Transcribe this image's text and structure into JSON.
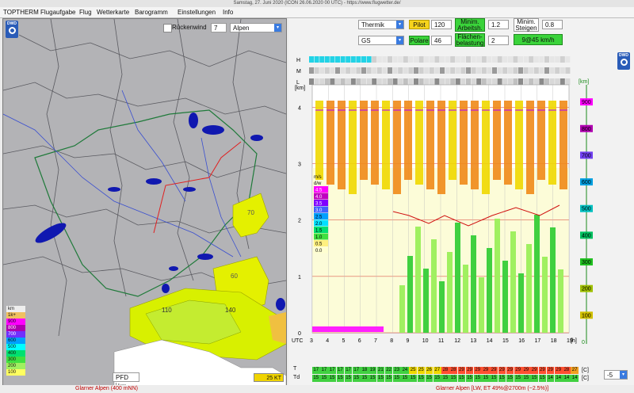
{
  "window_title": "Samstag, 27. Juni 2020 (ICON 26.06.2020 00 UTC) - https://www.flugwetter.de/",
  "menu": [
    "TOPTHERM",
    "Flugaufgabe",
    "Flug",
    "Wetterkarte",
    "Barogramm",
    "Einstellungen",
    "Info"
  ],
  "map": {
    "ruckenwind_label": "Rückenwind",
    "ruckenwind_value": "7",
    "region": "Alpen",
    "region_labels": [
      "70",
      "60",
      "110",
      "140"
    ],
    "pfd_label": "PFD",
    "km_label": "km",
    "wind_label": "25 KT",
    "legend_title": "km",
    "legend": [
      {
        "label": "1k+",
        "color": "#f0c060"
      },
      {
        "label": "900",
        "color": "#ff00ff"
      },
      {
        "label": "800",
        "color": "#b000b0"
      },
      {
        "label": "700",
        "color": "#7030ff"
      },
      {
        "label": "600",
        "color": "#00a0ff"
      },
      {
        "label": "500",
        "color": "#00ffff"
      },
      {
        "label": "400",
        "color": "#00e070"
      },
      {
        "label": "300",
        "color": "#40e040"
      },
      {
        "label": "200",
        "color": "#a0f060"
      },
      {
        "label": "100",
        "color": "#ffff60"
      }
    ]
  },
  "controls": {
    "mode": "Thermik",
    "pilot_label": "Pilot",
    "pilot_value": "120",
    "minim_arbeits_label1": "Minim.",
    "minim_arbeits_label2": "Arbeitsh.",
    "minim_arbeits_value": "1.2",
    "minim_steigen_label1": "Minim.",
    "minim_steigen_label2": "Steigen",
    "minim_steigen_value": "0.8",
    "glider": "GS",
    "polare_label": "Polare",
    "polare_value": "46",
    "flaechen_label1": "Flächen-",
    "flaechen_label2": "belastung",
    "flaechen_value": "2",
    "speed_button": "9@45 km/h"
  },
  "chart": {
    "rows_hml": [
      "H",
      "M",
      "L"
    ],
    "left_unit": "[km]",
    "left_ticks": [
      "0",
      "1",
      "2",
      "3",
      "4"
    ],
    "utc_label": "UTC",
    "hours": [
      "3",
      "4",
      "5",
      "6",
      "7",
      "8",
      "9",
      "10",
      "11",
      "12",
      "13",
      "14",
      "15",
      "16",
      "17",
      "18",
      "19"
    ],
    "hour_unit": "[h]",
    "right_unit": "[km]",
    "right_ticks": [
      "0",
      "100",
      "200",
      "300",
      "400",
      "500",
      "600",
      "700",
      "800",
      "900"
    ],
    "climb_legend_title": [
      "m/s",
      "d/w"
    ],
    "climb_legend": [
      {
        "label": "4.5",
        "color": "#ff00ff"
      },
      {
        "label": "4.0",
        "color": "#c000c0"
      },
      {
        "label": "3.5",
        "color": "#8000ff"
      },
      {
        "label": "3.0",
        "color": "#4060ff"
      },
      {
        "label": "2.5",
        "color": "#00a0ff"
      },
      {
        "label": "2.0",
        "color": "#00e0ff"
      },
      {
        "label": "1.5",
        "color": "#00e070"
      },
      {
        "label": "1.0",
        "color": "#40e040"
      },
      {
        "label": "0.5",
        "color": "#fff080"
      },
      {
        "label": "0.0",
        "color": "#ffffd0"
      }
    ],
    "T_label": "T",
    "Td_label": "Td",
    "T_values": [
      "17",
      "17",
      "17",
      "17",
      "17",
      "17",
      "18",
      "19",
      "21",
      "22",
      "23",
      "24",
      "25",
      "25",
      "26",
      "27",
      "28",
      "28",
      "29",
      "29",
      "29",
      "29",
      "29",
      "29",
      "29",
      "29",
      "29",
      "29",
      "29",
      "29",
      "29",
      "28",
      "27"
    ],
    "Td_values": [
      "15",
      "15",
      "15",
      "15",
      "15",
      "15",
      "15",
      "15",
      "15",
      "15",
      "15",
      "15",
      "15",
      "15",
      "15",
      "15",
      "15",
      "15",
      "15",
      "15",
      "15",
      "15",
      "15",
      "15",
      "15",
      "15",
      "15",
      "15",
      "15",
      "14",
      "14",
      "14",
      "14"
    ],
    "unit_c": "[C]",
    "offset_value": "-5"
  },
  "status": {
    "left": "Glarner Alpen (400 mNN)",
    "right": "Glarner Alpen [LW, ET  49%@2700m (~2.5%)]"
  }
}
